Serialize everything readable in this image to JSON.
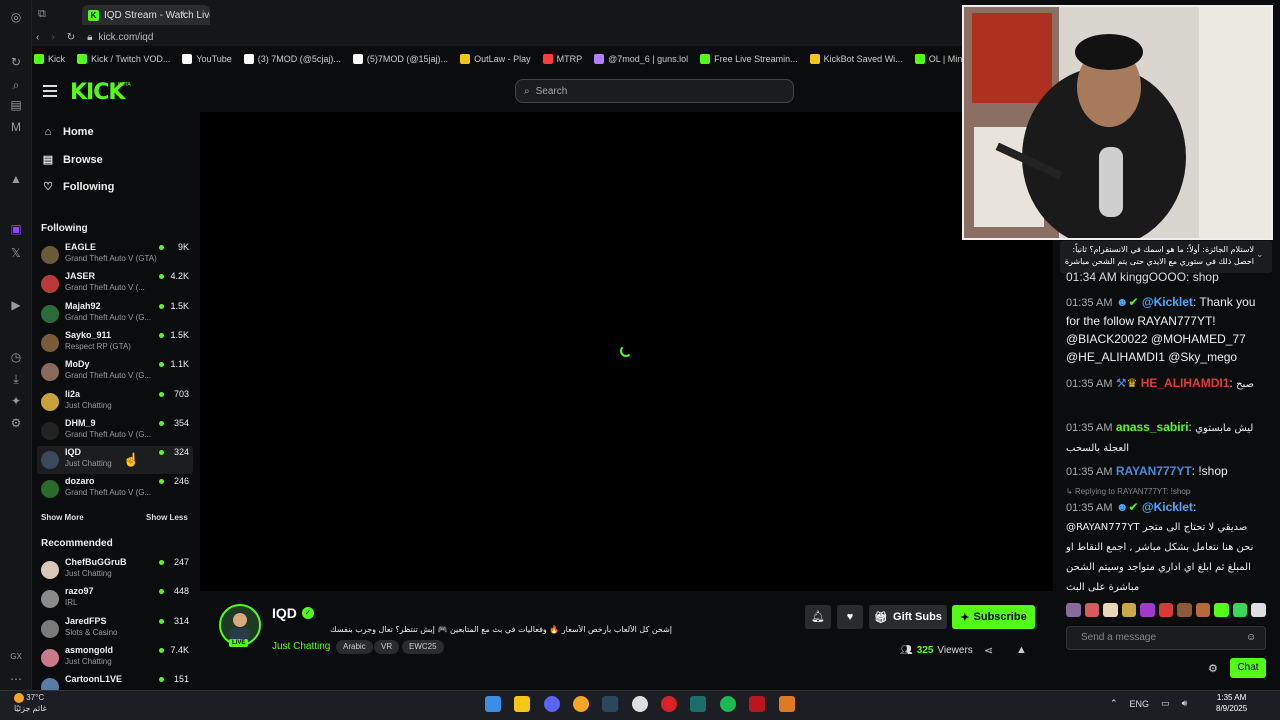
{
  "browser": {
    "tab_title": "IQD Stream - Watch Live",
    "url": "kick.com/iqd",
    "bookmarks": [
      {
        "label": "Kick",
        "color": "#53fc18"
      },
      {
        "label": "Kick / Twitch VOD...",
        "color": "#53fc18"
      },
      {
        "label": "YouTube",
        "color": "#ffffff"
      },
      {
        "label": "(3) 7MOD (@5cjaj)...",
        "color": "#ffffff"
      },
      {
        "label": "(5)7MOD (@15jaj)...",
        "color": "#ffffff"
      },
      {
        "label": "OutLaw - Play",
        "color": "#f5c518"
      },
      {
        "label": "MTRP",
        "color": "#ff3b3b"
      },
      {
        "label": "@7mod_6 | guns.lol",
        "color": "#b47cff"
      },
      {
        "label": "Free Live Streamin...",
        "color": "#53fc18"
      },
      {
        "label": "KickBot Saved Wi...",
        "color": "#f5c518"
      },
      {
        "label": "OL | Ministry of H...",
        "color": "#53fc18"
      }
    ]
  },
  "header": {
    "logo": "KICK",
    "logo_badge": "BETA",
    "search_placeholder": "Search"
  },
  "sidebar": {
    "nav": [
      {
        "label": "Home",
        "icon": "home-icon"
      },
      {
        "label": "Browse",
        "icon": "browse-icon"
      },
      {
        "label": "Following",
        "icon": "heart-icon"
      }
    ],
    "following_title": "Following",
    "following": [
      {
        "name": "EAGLE",
        "game": "Grand Theft Auto V (GTA)",
        "count": "9K",
        "color": "#6b5a3a"
      },
      {
        "name": "JASER",
        "game": "Grand Theft Auto V (...",
        "count": "4.2K",
        "color": "#b83a3a"
      },
      {
        "name": "Majah92",
        "game": "Grand Theft Auto V (G...",
        "count": "1.5K",
        "color": "#2e6b3a"
      },
      {
        "name": "Sayko_911",
        "game": "Respect RP (GTA)",
        "count": "1.5K",
        "color": "#7a5c3c"
      },
      {
        "name": "MoDy",
        "game": "Grand Theft Auto V (G...",
        "count": "1.1K",
        "color": "#8a6a5a"
      },
      {
        "name": "li2a",
        "game": "Just Chatting",
        "count": "703",
        "color": "#c8a23a"
      },
      {
        "name": "DHM_9",
        "game": "Grand Theft Auto V (G...",
        "count": "354",
        "color": "#222222"
      },
      {
        "name": "IQD",
        "game": "Just Chatting",
        "count": "324",
        "color": "#3a4a5a"
      },
      {
        "name": "dozaro",
        "game": "Grand Theft Auto V (G...",
        "count": "246",
        "color": "#2a6a2a"
      }
    ],
    "show_more": "Show More",
    "show_less": "Show Less",
    "recommended_title": "Recommended",
    "recommended": [
      {
        "name": "ChefBuGGruB",
        "game": "Just Chatting",
        "count": "247",
        "color": "#d8c8b8"
      },
      {
        "name": "razo97",
        "game": "IRL",
        "count": "448",
        "color": "#8a8a8a"
      },
      {
        "name": "JaredFPS",
        "game": "Slots & Casino",
        "count": "314",
        "color": "#7a7a7a"
      },
      {
        "name": "asmongold",
        "game": "Just Chatting",
        "count": "7.4K",
        "color": "#c87a8a"
      },
      {
        "name": "CartoonL1VE",
        "game": "",
        "count": "151",
        "color": "#5a7aa8"
      }
    ]
  },
  "stream": {
    "name": "IQD",
    "live": "LIVE",
    "title": "إشحن كل الألعاب بأرخص الأسعار 🔥 وفعاليات في بث مع المتابعين 🎮 إيش تنتظر؟ تعال وجرب بنفسك",
    "category": "Just Chatting",
    "tags": [
      "Arabic",
      "VR",
      "EWC25"
    ],
    "gift_label": "Gift Subs",
    "subscribe_label": "Subscribe",
    "viewers": "325",
    "viewers_label": "Viewers"
  },
  "chat": {
    "pinned": "لاستلام الجائزة: أولاً: ما هو اسمك في الانستقرام؟ ثانياً: احصل ذلك في ستوري مع الايدي حتى يتم الشحن مباشرة",
    "partial_line": "01:34 AM kinggOOOO: shop",
    "messages": [
      {
        "time": "01:35 AM",
        "user": "@Kicklet",
        "user_color": "#4aa8ff",
        "text": "Thank you for the follow RAYAN777YT! @BIACK20022 @MOHAMED_77 @HE_ALIHAMDI1 @Sky_mego"
      },
      {
        "time": "01:35 AM",
        "user": "HE_ALIHAMDI1",
        "user_color": "#e03a3a",
        "text": "صبح"
      },
      {
        "time": "01:35 AM",
        "user": "anass_sabiri",
        "user_color": "#53fc18",
        "text": "ليش مابستوي العجلة بالسحب"
      },
      {
        "time": "01:35 AM",
        "user": "RAYAN777YT",
        "user_color": "#4a8ad8",
        "text": "!shop"
      },
      {
        "time": "01:35 AM",
        "user": "@Kicklet",
        "user_color": "#4aa8ff",
        "text": "@RAYAN777YT صديقي لا تحتاج الى متجر نحن هنا نتعامل بشكل مباشر , اجمع النقاط او المبلغ ثم ابلغ اي اداري متواجد وسيتم الشحن مباشرة على البث"
      }
    ],
    "reply_hint": "Replying to RAYAN777YT: !shop",
    "input_placeholder": "Send a message",
    "send_label": "Chat"
  },
  "taskbar": {
    "temp": "37°C",
    "weather": "غائم جزئيًا",
    "lang": "ENG",
    "time": "1:35 AM",
    "date": "8/9/2025"
  }
}
